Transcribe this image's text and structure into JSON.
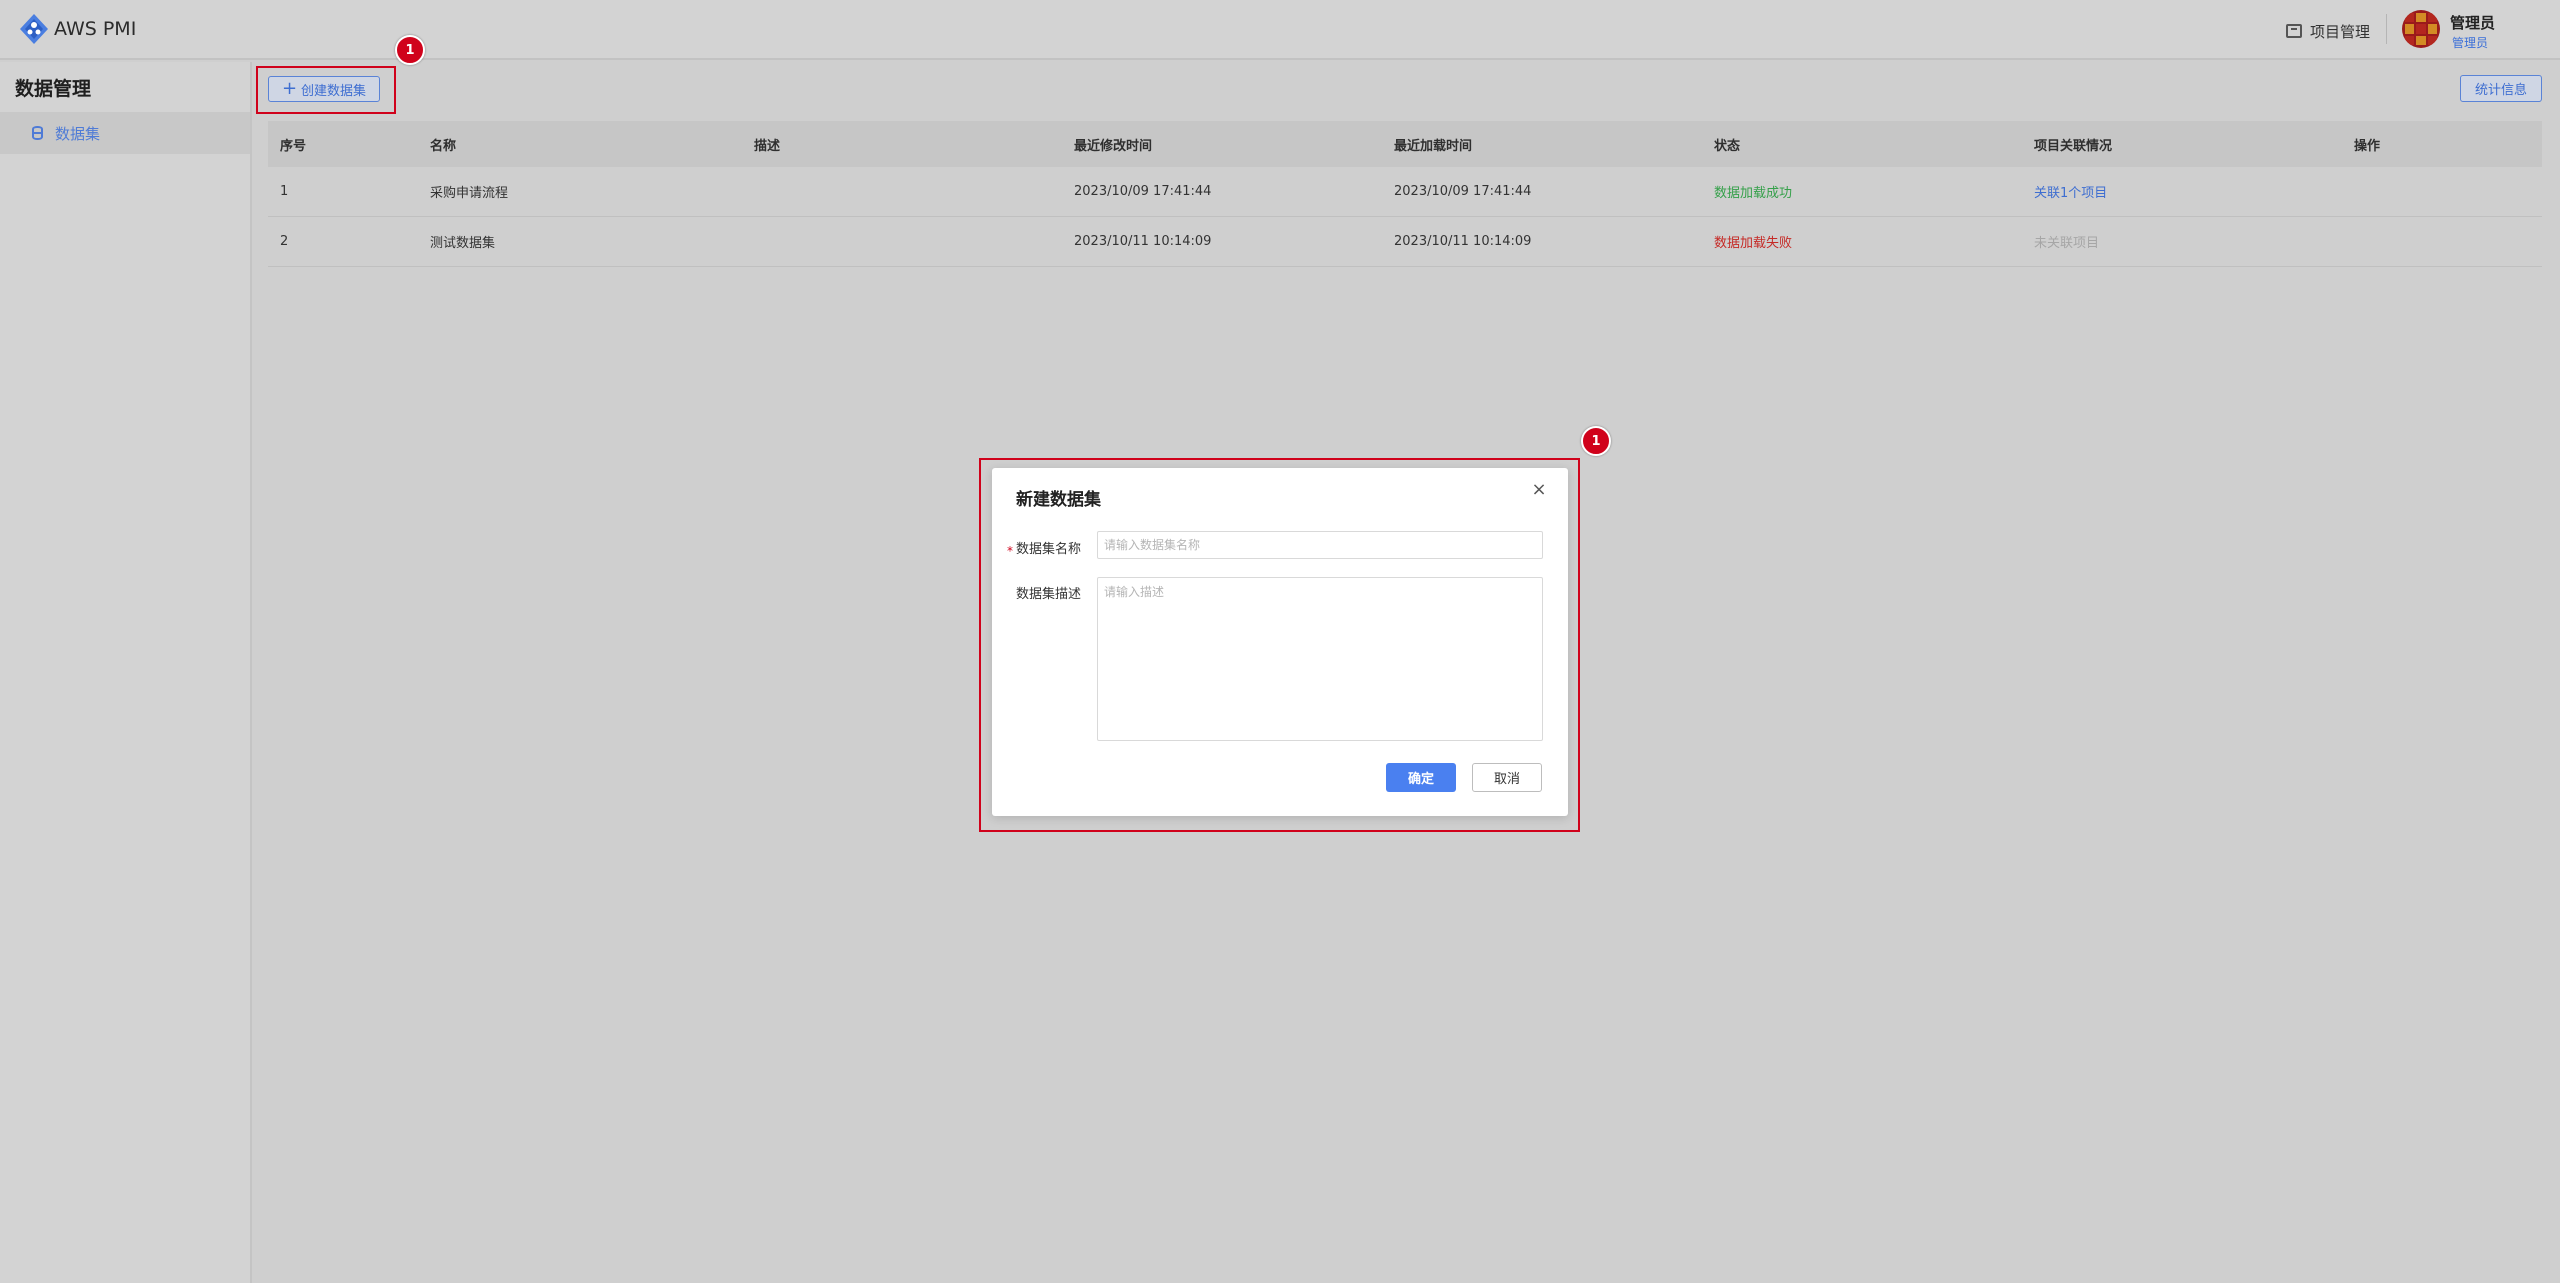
{
  "header": {
    "app_title": "AWS PMI",
    "project_management": "项目管理",
    "user_name": "管理员",
    "user_role": "管理员"
  },
  "sidebar": {
    "title": "数据管理",
    "items": [
      {
        "label": "数据集"
      }
    ]
  },
  "toolbar": {
    "create_label": "创建数据集",
    "stats_label": "统计信息"
  },
  "table": {
    "columns": [
      "序号",
      "名称",
      "描述",
      "最近修改时间",
      "最近加载时间",
      "状态",
      "项目关联情况",
      "操作"
    ],
    "rows": [
      {
        "index": "1",
        "name": "采购申请流程",
        "description": "",
        "modified": "2023/10/09 17:41:44",
        "loaded": "2023/10/09 17:41:44",
        "status": "数据加载成功",
        "status_color": "#35a04a",
        "association": "关联1个项目"
      },
      {
        "index": "2",
        "name": "测试数据集",
        "description": "",
        "modified": "2023/10/11 10:14:09",
        "loaded": "2023/10/11 10:14:09",
        "status": "数据加载失败",
        "status_color": "#c52a26",
        "association": "未关联项目"
      }
    ]
  },
  "annotations": {
    "badge_1": "1",
    "badge_2": "1",
    "color": "#d0021b"
  },
  "modal": {
    "title": "新建数据集",
    "required_mark": "*",
    "name_label": "数据集名称",
    "name_placeholder": "请输入数据集名称",
    "desc_label": "数据集描述",
    "desc_placeholder": "请输入描述",
    "ok_label": "确定",
    "cancel_label": "取消"
  },
  "colors": {
    "accent": "#4a80f0",
    "link": "#3e6ed1"
  }
}
